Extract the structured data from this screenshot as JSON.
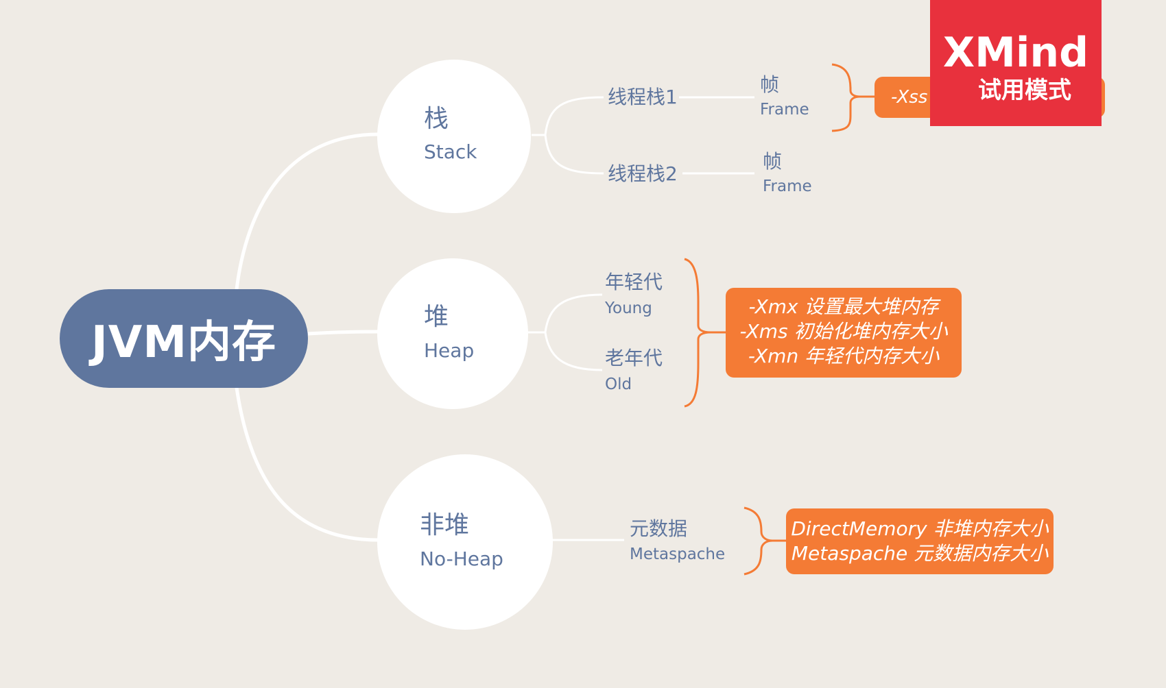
{
  "root": {
    "label": "JVM内存"
  },
  "branches": {
    "stack": {
      "label_zh": "栈",
      "label_en": "Stack",
      "children": [
        {
          "label": "线程栈1",
          "leaf_zh": "帧",
          "leaf_en": "Frame"
        },
        {
          "label": "线程栈2",
          "leaf_zh": "帧",
          "leaf_en": "Frame"
        }
      ],
      "note_lines": [
        "-Xss"
      ]
    },
    "heap": {
      "label_zh": "堆",
      "label_en": "Heap",
      "children": [
        {
          "label_zh": "年轻代",
          "label_en": "Young"
        },
        {
          "label_zh": "老年代",
          "label_en": "Old"
        }
      ],
      "note_lines": [
        "-Xmx 设置最大堆内存",
        "-Xms 初始化堆内存大小",
        "-Xmn 年轻代内存大小"
      ]
    },
    "nonheap": {
      "label_zh": "非堆",
      "label_en": "No-Heap",
      "children": [
        {
          "label_zh": "元数据",
          "label_en": "Metaspache"
        }
      ],
      "note_lines": [
        "DirectMemory 非堆内存大小",
        "Metaspache 元数据内存大小"
      ]
    }
  },
  "watermark": {
    "title": "XMind",
    "subtitle": "试用模式"
  },
  "colors": {
    "background": "#efebe5",
    "root_fill": "#5f769e",
    "text": "#5f769e",
    "connector": "#ffffff",
    "note_fill": "#f47b35",
    "watermark": "#e8313d"
  }
}
